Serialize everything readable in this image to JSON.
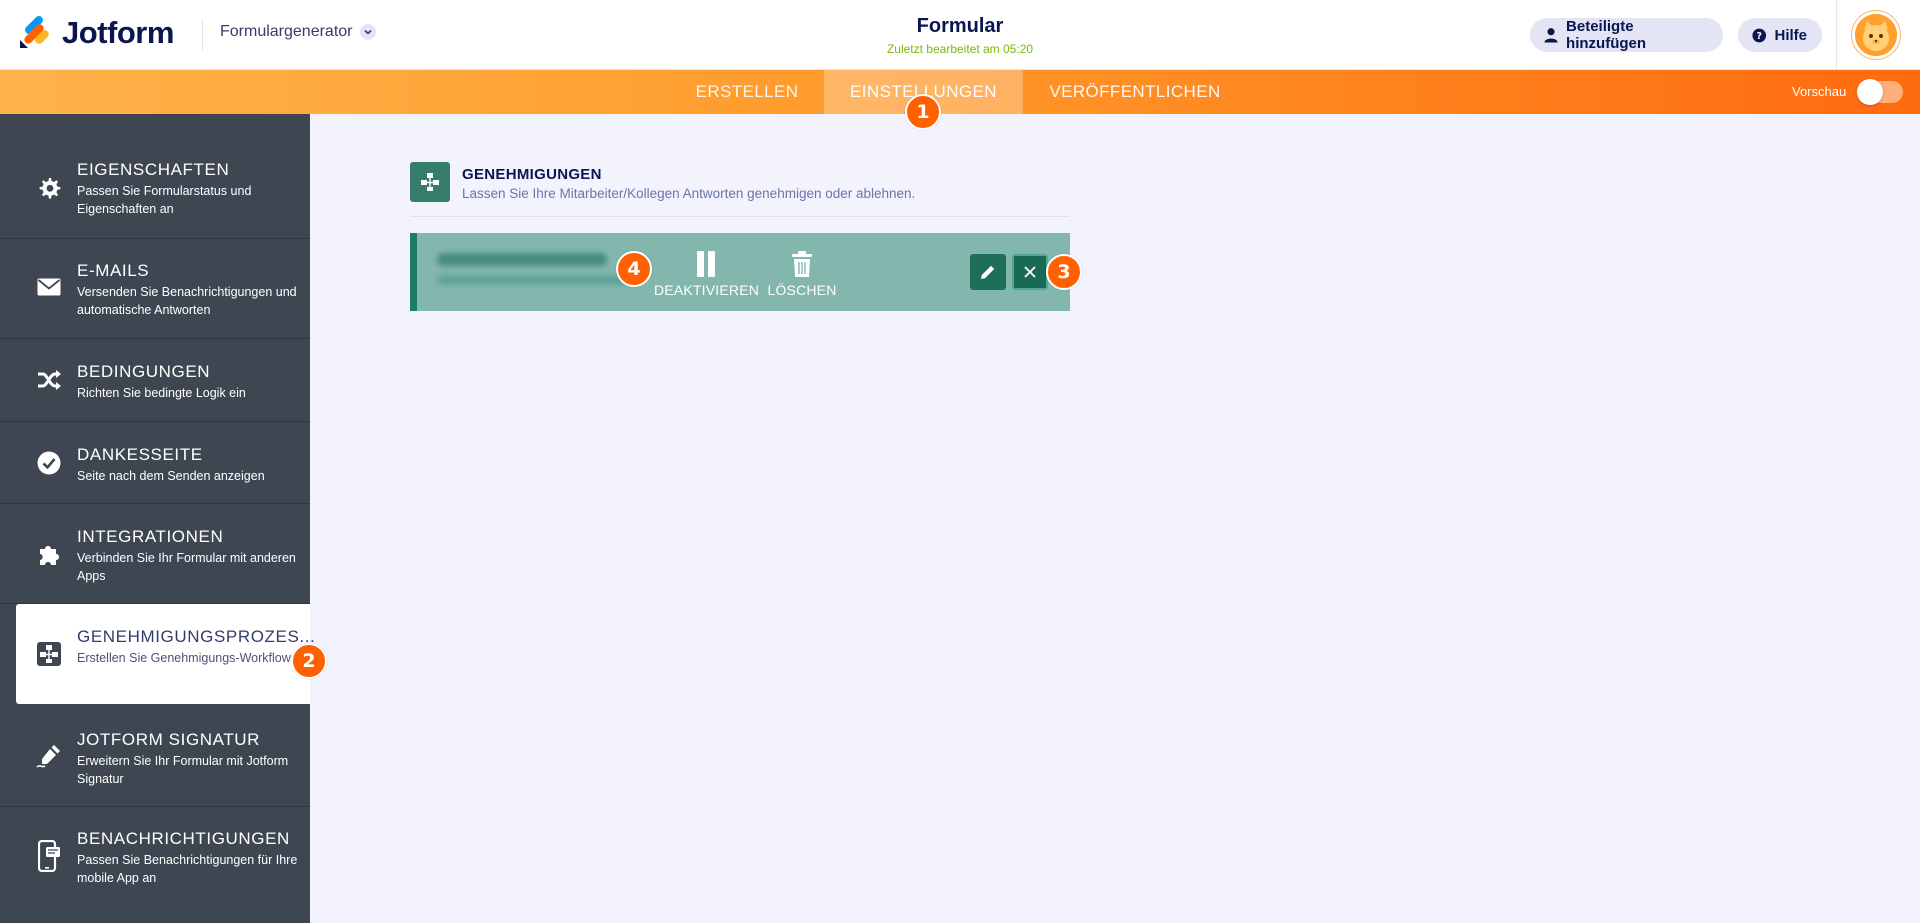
{
  "header": {
    "brand": "Jotform",
    "builder_label": "Formulargenerator",
    "form_title": "Formular",
    "form_subtitle": "Zuletzt bearbeitet am 05:20",
    "add_participants": "Beteiligte hinzufügen",
    "help": "Hilfe"
  },
  "nav": {
    "tabs": [
      {
        "label": "ERSTELLEN"
      },
      {
        "label": "EINSTELLUNGEN"
      },
      {
        "label": "VERÖFFENTLICHEN"
      }
    ],
    "active_tab": "EINSTELLUNGEN",
    "preview_label": "Vorschau",
    "preview_enabled": false
  },
  "sidebar": {
    "items": [
      {
        "title": "EIGENSCHAFTEN",
        "desc": "Passen Sie Formularstatus und Eigenschaften an",
        "icon": "gear-icon"
      },
      {
        "title": "E-MAILS",
        "desc": "Versenden Sie Benachrichtigungen und automatische Antworten",
        "icon": "envelope-icon"
      },
      {
        "title": "BEDINGUNGEN",
        "desc": "Richten Sie bedingte Logik ein",
        "icon": "shuffle-icon"
      },
      {
        "title": "DANKESSEITE",
        "desc": "Seite nach dem Senden anzeigen",
        "icon": "check-circle-icon"
      },
      {
        "title": "INTEGRATIONEN",
        "desc": "Verbinden Sie Ihr Formular mit anderen Apps",
        "icon": "puzzle-icon"
      },
      {
        "title": "GENEHMIGUNGSPROZES...",
        "desc": "Erstellen Sie Genehmigungs-Workflows",
        "icon": "approval-flow-icon"
      },
      {
        "title": "JOTFORM SIGNATUR",
        "desc": "Erweitern Sie Ihr Formular mit Jotform Signatur",
        "icon": "signature-icon"
      },
      {
        "title": "BENACHRICHTIGUNGEN",
        "desc": "Passen Sie Benachrichtigungen für Ihre mobile App an",
        "icon": "mobile-icon"
      }
    ],
    "active_index": 5
  },
  "main": {
    "section_title": "GENEHMIGUNGEN",
    "section_desc": "Lassen Sie Ihre Mitarbeiter/Kollegen Antworten genehmigen oder ablehnen.",
    "card": {
      "deactivate_label": "DEAKTIVIEREN",
      "delete_label": "LÖSCHEN"
    }
  },
  "badges": [
    "1",
    "2",
    "3",
    "4"
  ],
  "colors": {
    "brand_orange": "#ff6100",
    "sidebar_bg": "#3e4652",
    "approval_green": "#1d7b60",
    "subtitle_green": "#78bb07"
  }
}
